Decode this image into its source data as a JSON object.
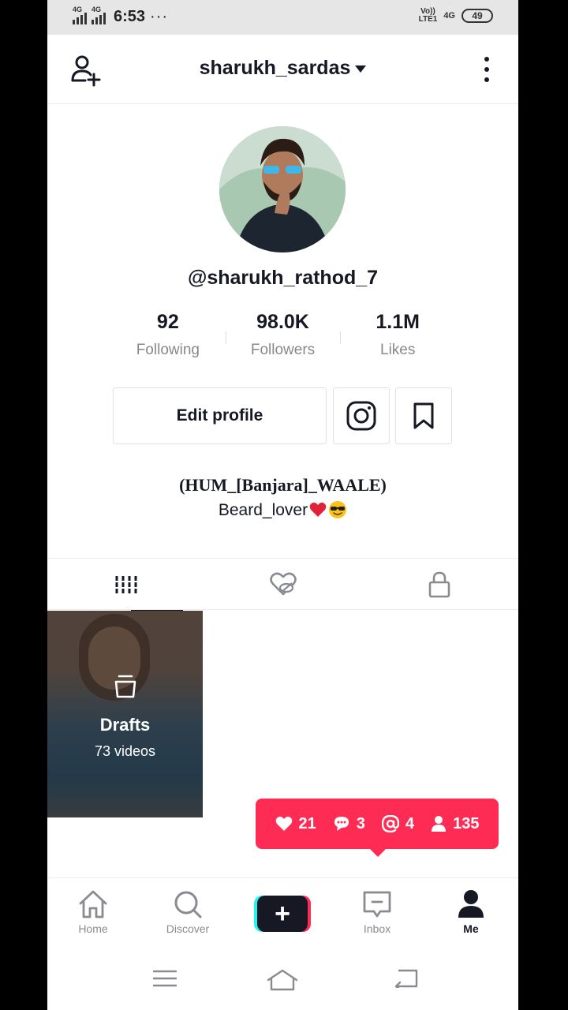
{
  "status_bar": {
    "time": "6:53",
    "dots": "···",
    "network_1": "4G",
    "network_2": "4G",
    "volte": "Vo))",
    "lte": "LTE1",
    "g4": "4G",
    "battery": "49"
  },
  "header": {
    "username": "sharukh_sardas",
    "add_user_icon": "add-user-icon",
    "more_icon": "more-vertical-icon"
  },
  "profile": {
    "handle": "@sharukh_rathod_7",
    "stats": [
      {
        "value": "92",
        "label": "Following"
      },
      {
        "value": "98.0K",
        "label": "Followers"
      },
      {
        "value": "1.1M",
        "label": "Likes"
      }
    ],
    "edit_profile_label": "Edit profile",
    "instagram_icon": "instagram-icon",
    "bookmark_icon": "bookmark-icon",
    "bio_line1": "(HUM_[Banjara]_WAALE)",
    "bio_line2": "Beard_lover"
  },
  "tabs": [
    {
      "name": "videos",
      "icon": "grid-icon",
      "active": true
    },
    {
      "name": "liked",
      "icon": "heart-hidden-icon",
      "active": false
    },
    {
      "name": "private",
      "icon": "lock-icon",
      "active": false
    }
  ],
  "drafts": {
    "title": "Drafts",
    "count": "73 videos"
  },
  "notifications": {
    "likes": "21",
    "comments": "3",
    "mentions": "4",
    "followers": "135",
    "color": "#fe2c55"
  },
  "bottom_nav": {
    "home": "Home",
    "discover": "Discover",
    "inbox": "Inbox",
    "me": "Me"
  },
  "colors": {
    "accent": "#fe2c55",
    "cyan": "#25f4ee",
    "text": "#161823",
    "muted": "#8a8b91"
  }
}
